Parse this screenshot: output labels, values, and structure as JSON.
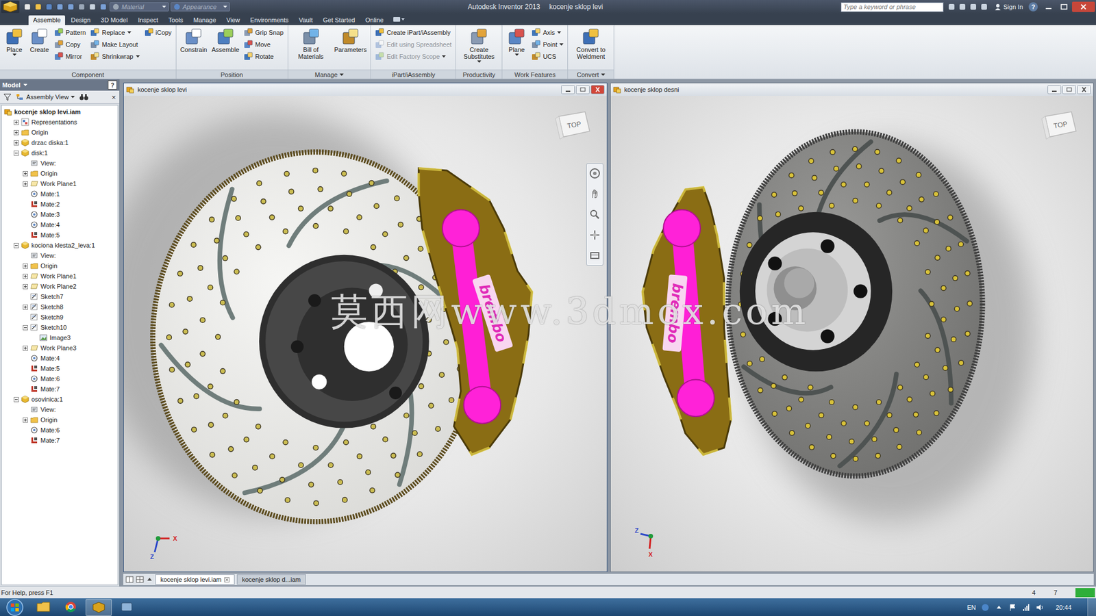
{
  "app": {
    "title": "Autodesk Inventor 2013",
    "document": "kocenje sklop levi",
    "search_placeholder": "Type a keyword or phrase",
    "sign_in": "Sign In",
    "help": "?"
  },
  "quick_access": {
    "material": "Material",
    "appearance": "Appearance"
  },
  "ribbon_tabs": [
    {
      "label": "Assemble",
      "selected": true
    },
    {
      "label": "Design",
      "selected": false
    },
    {
      "label": "3D Model",
      "selected": false
    },
    {
      "label": "Inspect",
      "selected": false
    },
    {
      "label": "Tools",
      "selected": false
    },
    {
      "label": "Manage",
      "selected": false
    },
    {
      "label": "View",
      "selected": false
    },
    {
      "label": "Environments",
      "selected": false
    },
    {
      "label": "Vault",
      "selected": false
    },
    {
      "label": "Get Started",
      "selected": false
    },
    {
      "label": "Online",
      "selected": false
    }
  ],
  "ribbon_groups": [
    {
      "title": "Component",
      "dropdown": false,
      "columns": [
        {
          "size": "large",
          "tools": [
            {
              "label": "Place",
              "disabled": false,
              "dropdown": true
            }
          ]
        },
        {
          "size": "large",
          "tools": [
            {
              "label": "Create",
              "disabled": false,
              "dropdown": false
            }
          ]
        },
        {
          "size": "small",
          "tools": [
            {
              "label": "Pattern",
              "disabled": false,
              "dropdown": false
            },
            {
              "label": "Copy",
              "disabled": false,
              "dropdown": false
            },
            {
              "label": "Mirror",
              "disabled": false,
              "dropdown": false
            }
          ]
        },
        {
          "size": "small",
          "tools": [
            {
              "label": "Replace",
              "disabled": false,
              "dropdown": true
            },
            {
              "label": "Make Layout",
              "disabled": false,
              "dropdown": false
            },
            {
              "label": "Shrinkwrap",
              "disabled": false,
              "dropdown": true
            }
          ]
        },
        {
          "size": "small",
          "tools": [
            {
              "label": "iCopy",
              "disabled": false,
              "dropdown": false
            }
          ]
        }
      ]
    },
    {
      "title": "Position",
      "dropdown": false,
      "columns": [
        {
          "size": "large",
          "tools": [
            {
              "label": "Constrain",
              "disabled": false,
              "dropdown": false
            }
          ]
        },
        {
          "size": "large",
          "tools": [
            {
              "label": "Assemble",
              "disabled": false,
              "dropdown": false
            }
          ]
        },
        {
          "size": "small",
          "tools": [
            {
              "label": "Grip Snap",
              "disabled": false,
              "dropdown": false
            },
            {
              "label": "Move",
              "disabled": false,
              "dropdown": false
            },
            {
              "label": "Rotate",
              "disabled": false,
              "dropdown": false
            }
          ]
        }
      ]
    },
    {
      "title": "Manage",
      "dropdown": true,
      "columns": [
        {
          "size": "large",
          "tools": [
            {
              "label": "Bill of Materials",
              "disabled": false,
              "dropdown": false
            }
          ]
        },
        {
          "size": "large",
          "tools": [
            {
              "label": "Parameters",
              "disabled": false,
              "dropdown": false
            }
          ]
        }
      ]
    },
    {
      "title": "iPart/iAssembly",
      "dropdown": false,
      "columns": [
        {
          "size": "small",
          "tools": [
            {
              "label": "Create iPart/iAssembly",
              "disabled": false,
              "dropdown": false
            },
            {
              "label": "Edit using Spreadsheet",
              "disabled": true,
              "dropdown": false
            },
            {
              "label": "Edit Factory Scope",
              "disabled": true,
              "dropdown": true
            }
          ]
        }
      ]
    },
    {
      "title": "Productivity",
      "dropdown": false,
      "columns": [
        {
          "size": "large",
          "tools": [
            {
              "label": "Create Substitutes",
              "disabled": false,
              "dropdown": true
            }
          ]
        }
      ]
    },
    {
      "title": "Work Features",
      "dropdown": false,
      "columns": [
        {
          "size": "large",
          "tools": [
            {
              "label": "Plane",
              "disabled": false,
              "dropdown": true
            }
          ]
        },
        {
          "size": "small",
          "tools": [
            {
              "label": "Axis",
              "disabled": false,
              "dropdown": true
            },
            {
              "label": "Point",
              "disabled": false,
              "dropdown": true
            },
            {
              "label": "UCS",
              "disabled": false,
              "dropdown": false
            }
          ]
        }
      ]
    },
    {
      "title": "Convert",
      "dropdown": true,
      "columns": [
        {
          "size": "large",
          "tools": [
            {
              "label": "Convert to Weldment",
              "disabled": false,
              "dropdown": false
            }
          ]
        }
      ]
    }
  ],
  "browser": {
    "title": "Model",
    "help": "?",
    "close": "×",
    "view": "Assembly View",
    "tree": [
      {
        "label": "kocenje sklop levi.iam",
        "level": 0,
        "kind": "root",
        "expandable": false,
        "expanded": false
      },
      {
        "label": "Representations",
        "level": 1,
        "kind": "representations",
        "expandable": true,
        "expanded": false
      },
      {
        "label": "Origin",
        "level": 1,
        "kind": "folder",
        "expandable": true,
        "expanded": false
      },
      {
        "label": "drzac diska:1",
        "level": 1,
        "kind": "part",
        "expandable": true,
        "expanded": false
      },
      {
        "label": "disk:1",
        "level": 1,
        "kind": "part",
        "expandable": true,
        "expanded": true
      },
      {
        "label": "View:",
        "level": 2,
        "kind": "view",
        "expandable": false,
        "expanded": false
      },
      {
        "label": "Origin",
        "level": 2,
        "kind": "folder",
        "expandable": true,
        "expanded": false
      },
      {
        "label": "Work Plane1",
        "level": 2,
        "kind": "workplane",
        "expandable": true,
        "expanded": false
      },
      {
        "label": "Mate:1",
        "level": 2,
        "kind": "mate",
        "expandable": false,
        "expanded": false
      },
      {
        "label": "Mate:2",
        "level": 2,
        "kind": "flush",
        "expandable": false,
        "expanded": false
      },
      {
        "label": "Mate:3",
        "level": 2,
        "kind": "mate",
        "expandable": false,
        "expanded": false
      },
      {
        "label": "Mate:4",
        "level": 2,
        "kind": "mate",
        "expandable": false,
        "expanded": false
      },
      {
        "label": "Mate:5",
        "level": 2,
        "kind": "flush",
        "expandable": false,
        "expanded": false
      },
      {
        "label": "kociona klesta2_leva:1",
        "level": 1,
        "kind": "part",
        "expandable": true,
        "expanded": true
      },
      {
        "label": "View:",
        "level": 2,
        "kind": "view",
        "expandable": false,
        "expanded": false
      },
      {
        "label": "Origin",
        "level": 2,
        "kind": "folder",
        "expandable": true,
        "expanded": false
      },
      {
        "label": "Work Plane1",
        "level": 2,
        "kind": "workplane",
        "expandable": true,
        "expanded": false
      },
      {
        "label": "Work Plane2",
        "level": 2,
        "kind": "workplane",
        "expandable": true,
        "expanded": false
      },
      {
        "label": "Sketch7",
        "level": 2,
        "kind": "sketch",
        "expandable": false,
        "expanded": false
      },
      {
        "label": "Sketch8",
        "level": 2,
        "kind": "sketch",
        "expandable": true,
        "expanded": false
      },
      {
        "label": "Sketch9",
        "level": 2,
        "kind": "sketch",
        "expandable": false,
        "expanded": false
      },
      {
        "label": "Sketch10",
        "level": 2,
        "kind": "sketch",
        "expandable": true,
        "expanded": true
      },
      {
        "label": "Image3",
        "level": 3,
        "kind": "image",
        "expandable": false,
        "expanded": false
      },
      {
        "label": "Work Plane3",
        "level": 2,
        "kind": "workplane",
        "expandable": true,
        "expanded": false
      },
      {
        "label": "Mate:4",
        "level": 2,
        "kind": "mate",
        "expandable": false,
        "expanded": false
      },
      {
        "label": "Mate:5",
        "level": 2,
        "kind": "flush",
        "expandable": false,
        "expanded": false
      },
      {
        "label": "Mate:6",
        "level": 2,
        "kind": "mate",
        "expandable": false,
        "expanded": false
      },
      {
        "label": "Mate:7",
        "level": 2,
        "kind": "flush",
        "expandable": false,
        "expanded": false
      },
      {
        "label": "osovinica:1",
        "level": 1,
        "kind": "part",
        "expandable": true,
        "expanded": true
      },
      {
        "label": "View:",
        "level": 2,
        "kind": "view",
        "expandable": false,
        "expanded": false
      },
      {
        "label": "Origin",
        "level": 2,
        "kind": "folder",
        "expandable": true,
        "expanded": false
      },
      {
        "label": "Mate:6",
        "level": 2,
        "kind": "mate",
        "expandable": false,
        "expanded": false
      },
      {
        "label": "Mate:7",
        "level": 2,
        "kind": "flush",
        "expandable": false,
        "expanded": false
      }
    ]
  },
  "viewports": [
    {
      "title": "kocenje sklop levi",
      "active": true,
      "cube_label": "TOP",
      "logo": "brembo",
      "axes": [
        {
          "label": "X",
          "color": "#d21f1f"
        },
        {
          "label": "Z",
          "color": "#2a46c8"
        }
      ]
    },
    {
      "title": "kocenje sklop desni",
      "active": false,
      "cube_label": "TOP",
      "logo": "brembo",
      "axes": [
        {
          "label": "Z",
          "color": "#2a46c8"
        },
        {
          "label": "X",
          "color": "#d21f1f"
        }
      ]
    }
  ],
  "watermark": "莫西网www.3dmox.com",
  "doc_tabs": [
    {
      "label": "kocenje sklop levi.iam",
      "selected": true
    },
    {
      "label": "kocenje sklop d...iam",
      "selected": false
    }
  ],
  "status_bar": {
    "help": "For Help, press F1",
    "counts": [
      "4",
      "7"
    ]
  },
  "taskbar": {
    "language": "EN",
    "time": "20:44"
  }
}
